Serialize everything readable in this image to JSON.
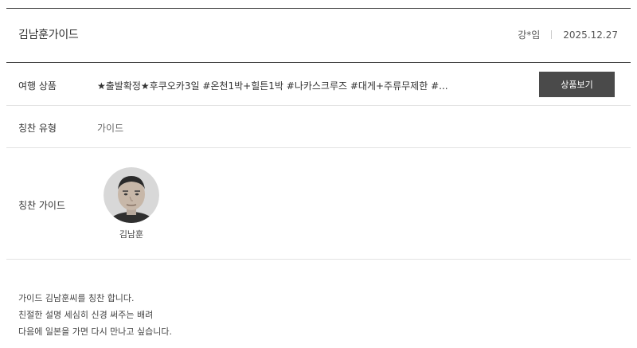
{
  "header": {
    "title": "김남훈가이드",
    "author": "강*임",
    "date": "2025.12.27"
  },
  "product": {
    "label": "여행 상품",
    "name": "★출발확정★후쿠오카3일 #온천1박+힐튼1박 #나카스크루즈 #대게+주류무제한 #...",
    "button_label": "상품보기"
  },
  "praise_type": {
    "label": "칭찬 유형",
    "value": "가이드"
  },
  "praise_guide": {
    "label": "칭찬 가이드",
    "name": "김남훈"
  },
  "content": {
    "lines": [
      "가이드 김남훈씨를 칭찬 합니다.",
      "친절한 설명 세심히 신경 써주는 배려",
      "다음에 일본을 가면 다시 만나고 싶습니다."
    ]
  }
}
